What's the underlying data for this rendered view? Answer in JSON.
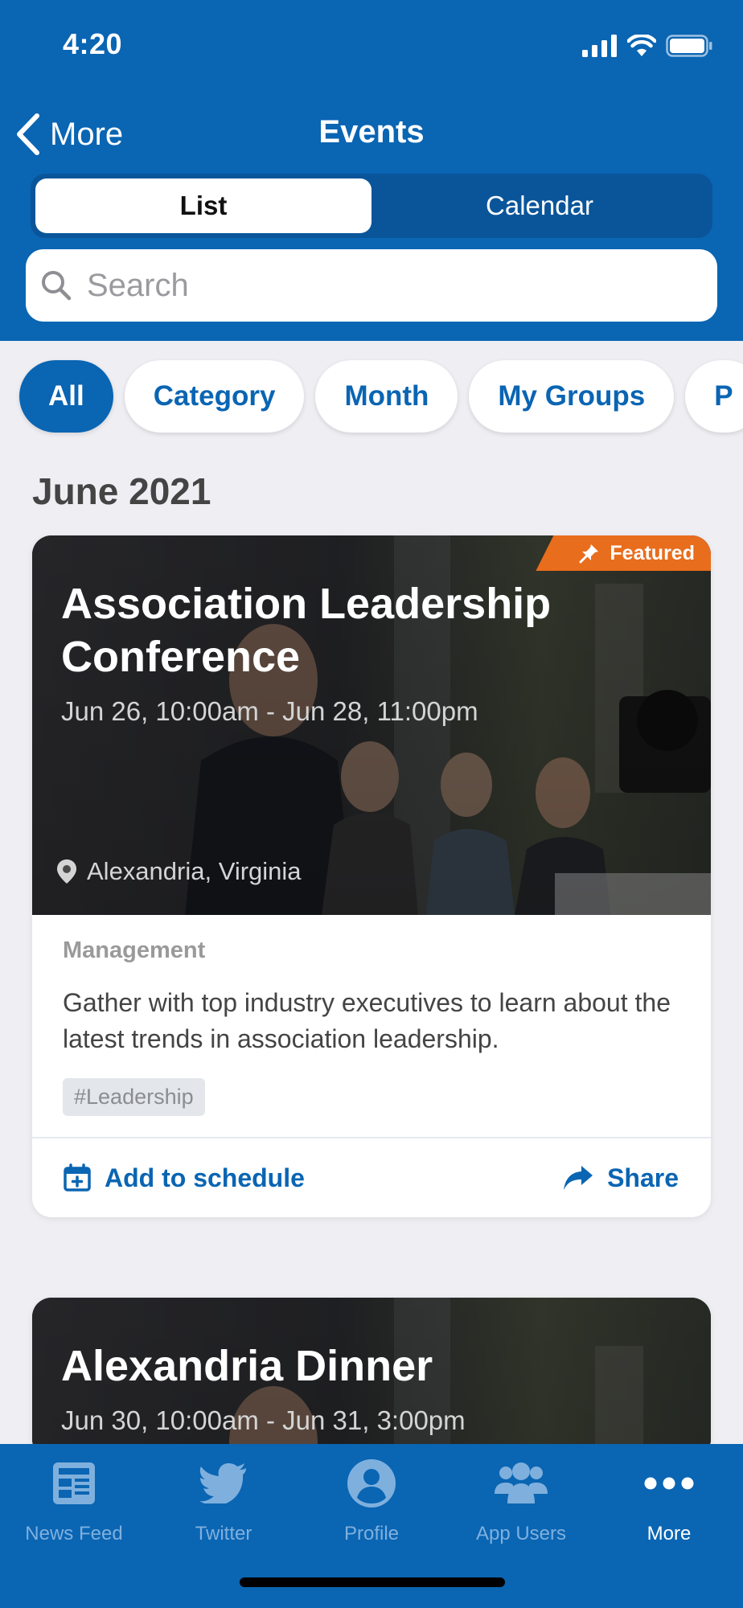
{
  "status_bar": {
    "time": "4:20"
  },
  "nav": {
    "back_label": "More",
    "title": "Events"
  },
  "segments": [
    {
      "label": "List",
      "active": true
    },
    {
      "label": "Calendar",
      "active": false
    }
  ],
  "search": {
    "placeholder": "Search",
    "value": ""
  },
  "filters": [
    {
      "label": "All",
      "active": true
    },
    {
      "label": "Category",
      "active": false
    },
    {
      "label": "Month",
      "active": false
    },
    {
      "label": "My Groups",
      "active": false
    },
    {
      "label": "P",
      "active": false
    }
  ],
  "section": {
    "title": "June 2021"
  },
  "events": [
    {
      "featured_label": "Featured",
      "title": "Association Leadership Conference",
      "date": "Jun 26, 10:00am - Jun 28, 11:00pm",
      "location": "Alexandria, Virginia",
      "category": "Management",
      "description": "Gather with top industry executives to learn about the latest trends in association leadership.",
      "tag": "#Leadership",
      "add_label": "Add to schedule",
      "share_label": "Share"
    },
    {
      "title": "Alexandria Dinner",
      "date": "Jun 30, 10:00am - Jun 31, 3:00pm"
    }
  ],
  "tabbar": [
    {
      "label": "News Feed",
      "icon": "news-feed-icon",
      "active": false
    },
    {
      "label": "Twitter",
      "icon": "twitter-icon",
      "active": false
    },
    {
      "label": "Profile",
      "icon": "profile-icon",
      "active": false
    },
    {
      "label": "App Users",
      "icon": "app-users-icon",
      "active": false
    },
    {
      "label": "More",
      "icon": "more-icon",
      "active": true
    }
  ],
  "colors": {
    "brand_blue": "#0a65b3",
    "featured_orange": "#e86d1c",
    "background": "#eeeef3"
  }
}
